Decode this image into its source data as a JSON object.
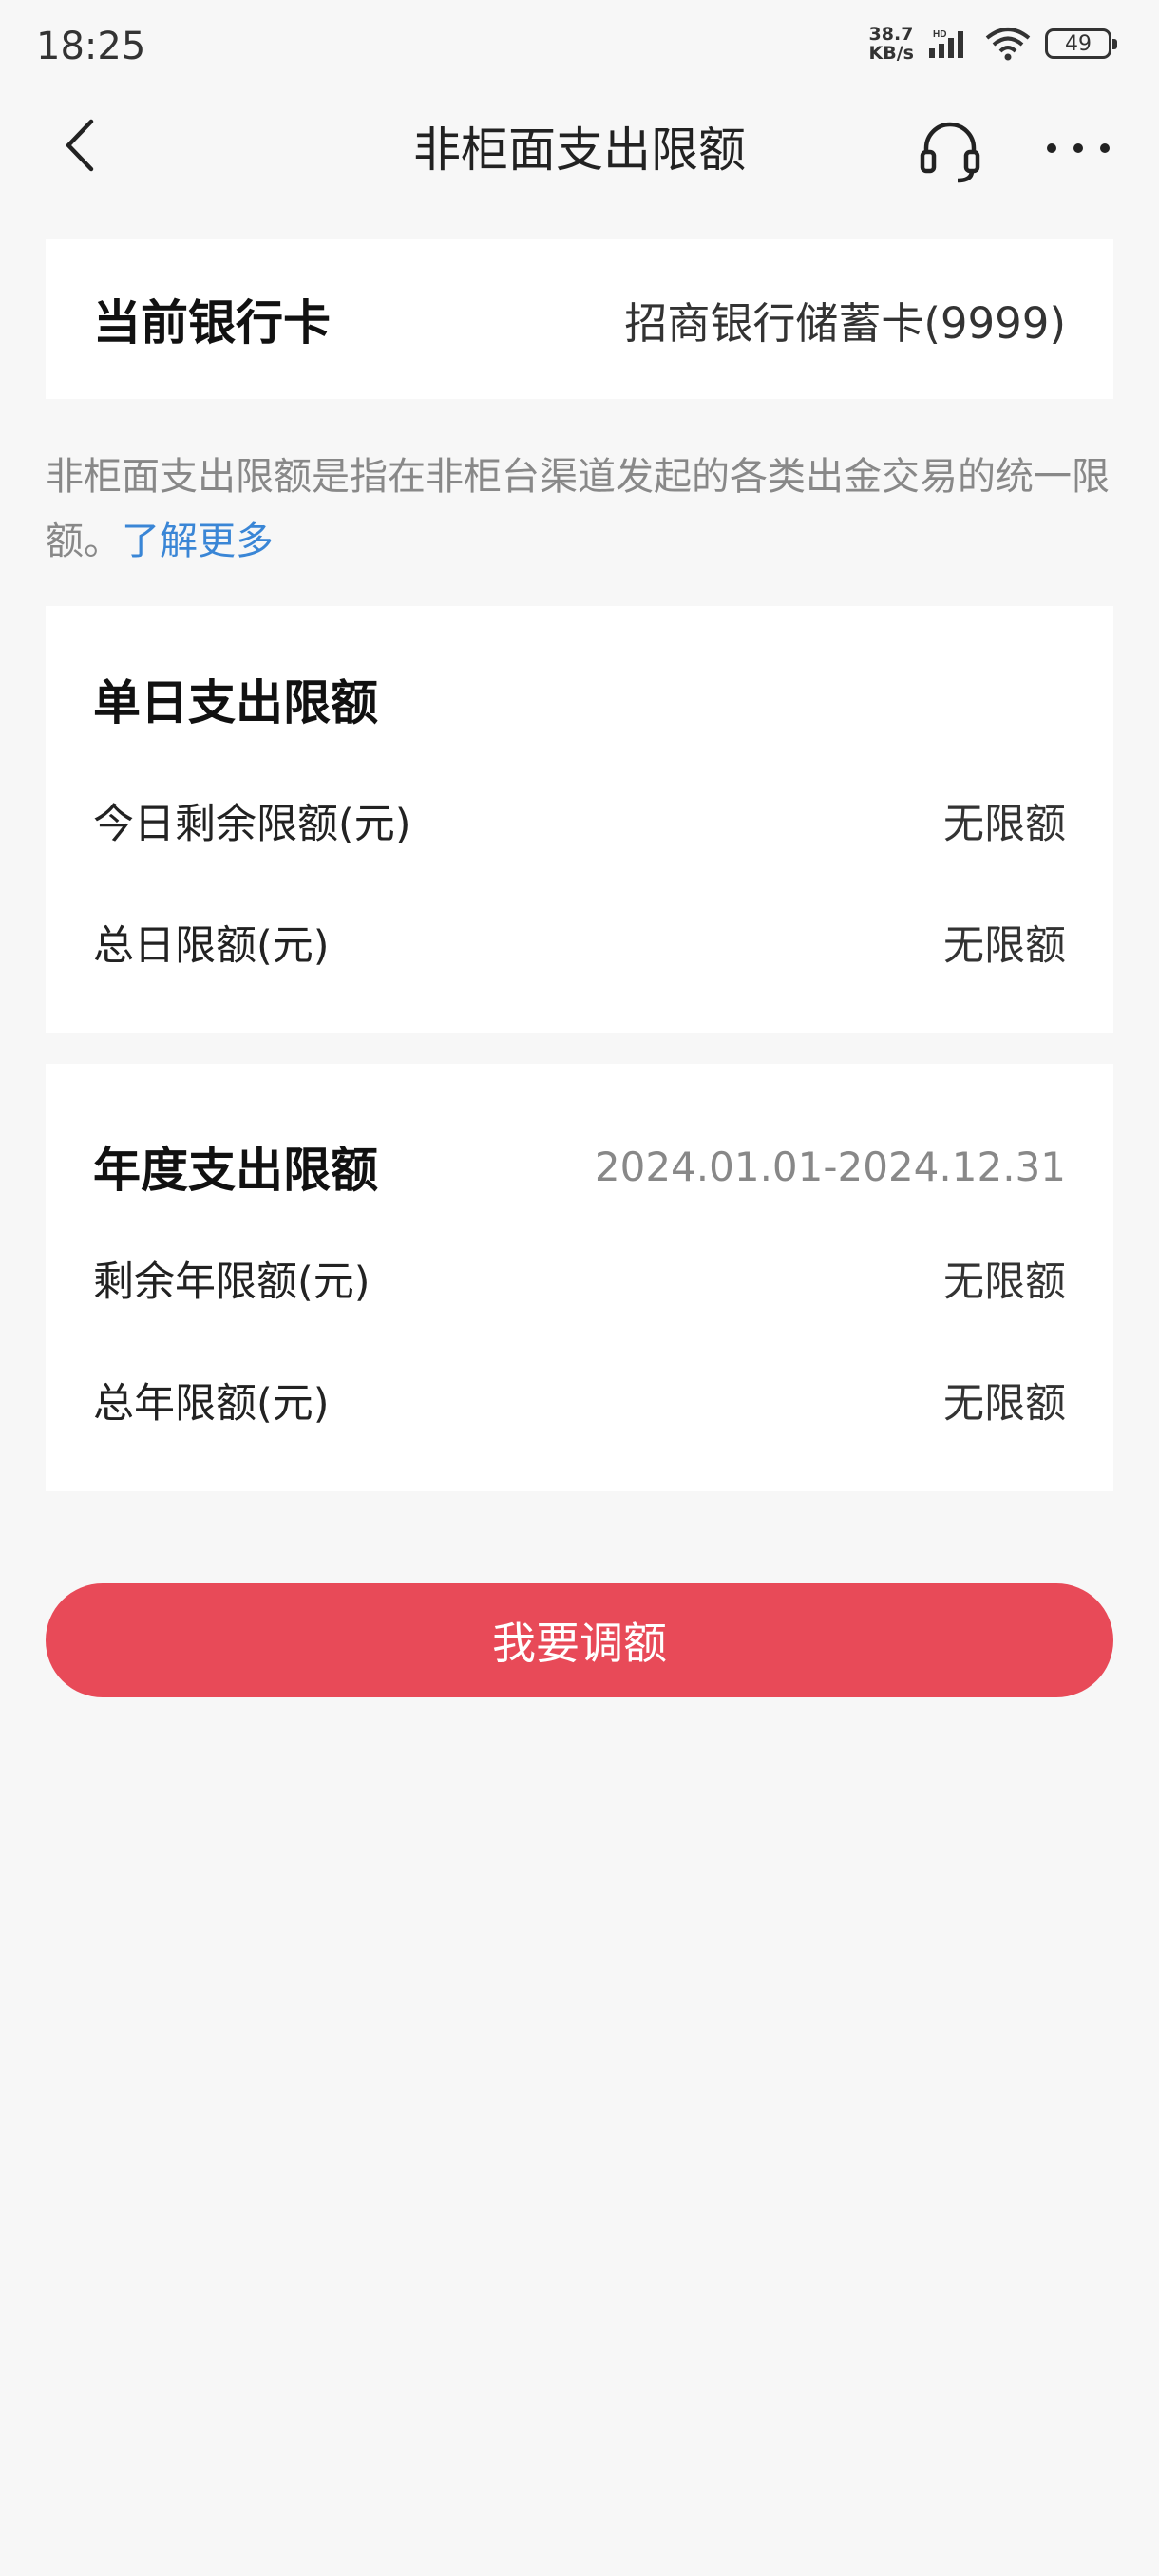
{
  "status_bar": {
    "time": "18:25",
    "net_speed_line1": "38.7",
    "net_speed_line2": "KB/s",
    "hd_label": "HD",
    "battery": "49"
  },
  "nav": {
    "title": "非柜面支出限额",
    "back_icon": "chevron-left-icon",
    "service_icon": "headset-icon",
    "more_icon": "more-dots-icon"
  },
  "card_info": {
    "label": "当前银行卡",
    "value": "招商银行储蓄卡(9999)"
  },
  "description": {
    "text": "非柜面支出限额是指在非柜台渠道发起的各类出金交易的统一限额。",
    "link": "了解更多"
  },
  "daily": {
    "title": "单日支出限额",
    "items": [
      {
        "label": "今日剩余限额(元)",
        "value": "无限额"
      },
      {
        "label": "总日限额(元)",
        "value": "无限额"
      }
    ]
  },
  "yearly": {
    "title": "年度支出限额",
    "period": "2024.01.01-2024.12.31",
    "items": [
      {
        "label": "剩余年限额(元)",
        "value": "无限额"
      },
      {
        "label": "总年限额(元)",
        "value": "无限额"
      }
    ]
  },
  "action": {
    "adjust_label": "我要调额"
  },
  "colors": {
    "accent": "#e84a58",
    "link": "#3a86d6",
    "background": "#f7f7f7"
  }
}
